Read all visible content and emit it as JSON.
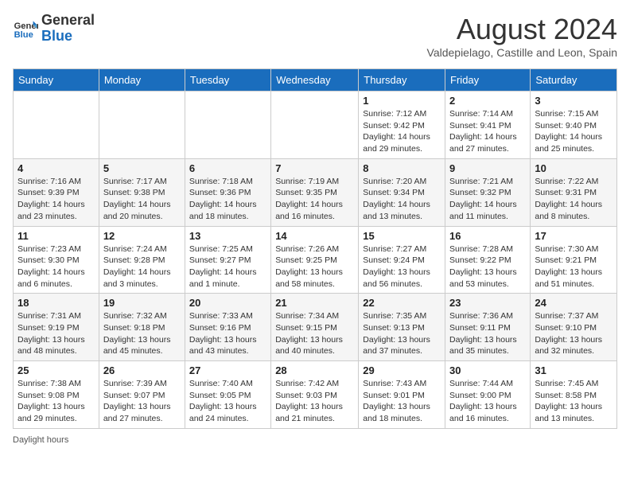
{
  "header": {
    "logo_line1": "General",
    "logo_line2": "Blue",
    "month_year": "August 2024",
    "location": "Valdepielago, Castille and Leon, Spain"
  },
  "footer": {
    "daylight_label": "Daylight hours"
  },
  "weekdays": [
    "Sunday",
    "Monday",
    "Tuesday",
    "Wednesday",
    "Thursday",
    "Friday",
    "Saturday"
  ],
  "weeks": [
    [
      {
        "day": "",
        "info": ""
      },
      {
        "day": "",
        "info": ""
      },
      {
        "day": "",
        "info": ""
      },
      {
        "day": "",
        "info": ""
      },
      {
        "day": "1",
        "info": "Sunrise: 7:12 AM\nSunset: 9:42 PM\nDaylight: 14 hours\nand 29 minutes."
      },
      {
        "day": "2",
        "info": "Sunrise: 7:14 AM\nSunset: 9:41 PM\nDaylight: 14 hours\nand 27 minutes."
      },
      {
        "day": "3",
        "info": "Sunrise: 7:15 AM\nSunset: 9:40 PM\nDaylight: 14 hours\nand 25 minutes."
      }
    ],
    [
      {
        "day": "4",
        "info": "Sunrise: 7:16 AM\nSunset: 9:39 PM\nDaylight: 14 hours\nand 23 minutes."
      },
      {
        "day": "5",
        "info": "Sunrise: 7:17 AM\nSunset: 9:38 PM\nDaylight: 14 hours\nand 20 minutes."
      },
      {
        "day": "6",
        "info": "Sunrise: 7:18 AM\nSunset: 9:36 PM\nDaylight: 14 hours\nand 18 minutes."
      },
      {
        "day": "7",
        "info": "Sunrise: 7:19 AM\nSunset: 9:35 PM\nDaylight: 14 hours\nand 16 minutes."
      },
      {
        "day": "8",
        "info": "Sunrise: 7:20 AM\nSunset: 9:34 PM\nDaylight: 14 hours\nand 13 minutes."
      },
      {
        "day": "9",
        "info": "Sunrise: 7:21 AM\nSunset: 9:32 PM\nDaylight: 14 hours\nand 11 minutes."
      },
      {
        "day": "10",
        "info": "Sunrise: 7:22 AM\nSunset: 9:31 PM\nDaylight: 14 hours\nand 8 minutes."
      }
    ],
    [
      {
        "day": "11",
        "info": "Sunrise: 7:23 AM\nSunset: 9:30 PM\nDaylight: 14 hours\nand 6 minutes."
      },
      {
        "day": "12",
        "info": "Sunrise: 7:24 AM\nSunset: 9:28 PM\nDaylight: 14 hours\nand 3 minutes."
      },
      {
        "day": "13",
        "info": "Sunrise: 7:25 AM\nSunset: 9:27 PM\nDaylight: 14 hours\nand 1 minute."
      },
      {
        "day": "14",
        "info": "Sunrise: 7:26 AM\nSunset: 9:25 PM\nDaylight: 13 hours\nand 58 minutes."
      },
      {
        "day": "15",
        "info": "Sunrise: 7:27 AM\nSunset: 9:24 PM\nDaylight: 13 hours\nand 56 minutes."
      },
      {
        "day": "16",
        "info": "Sunrise: 7:28 AM\nSunset: 9:22 PM\nDaylight: 13 hours\nand 53 minutes."
      },
      {
        "day": "17",
        "info": "Sunrise: 7:30 AM\nSunset: 9:21 PM\nDaylight: 13 hours\nand 51 minutes."
      }
    ],
    [
      {
        "day": "18",
        "info": "Sunrise: 7:31 AM\nSunset: 9:19 PM\nDaylight: 13 hours\nand 48 minutes."
      },
      {
        "day": "19",
        "info": "Sunrise: 7:32 AM\nSunset: 9:18 PM\nDaylight: 13 hours\nand 45 minutes."
      },
      {
        "day": "20",
        "info": "Sunrise: 7:33 AM\nSunset: 9:16 PM\nDaylight: 13 hours\nand 43 minutes."
      },
      {
        "day": "21",
        "info": "Sunrise: 7:34 AM\nSunset: 9:15 PM\nDaylight: 13 hours\nand 40 minutes."
      },
      {
        "day": "22",
        "info": "Sunrise: 7:35 AM\nSunset: 9:13 PM\nDaylight: 13 hours\nand 37 minutes."
      },
      {
        "day": "23",
        "info": "Sunrise: 7:36 AM\nSunset: 9:11 PM\nDaylight: 13 hours\nand 35 minutes."
      },
      {
        "day": "24",
        "info": "Sunrise: 7:37 AM\nSunset: 9:10 PM\nDaylight: 13 hours\nand 32 minutes."
      }
    ],
    [
      {
        "day": "25",
        "info": "Sunrise: 7:38 AM\nSunset: 9:08 PM\nDaylight: 13 hours\nand 29 minutes."
      },
      {
        "day": "26",
        "info": "Sunrise: 7:39 AM\nSunset: 9:07 PM\nDaylight: 13 hours\nand 27 minutes."
      },
      {
        "day": "27",
        "info": "Sunrise: 7:40 AM\nSunset: 9:05 PM\nDaylight: 13 hours\nand 24 minutes."
      },
      {
        "day": "28",
        "info": "Sunrise: 7:42 AM\nSunset: 9:03 PM\nDaylight: 13 hours\nand 21 minutes."
      },
      {
        "day": "29",
        "info": "Sunrise: 7:43 AM\nSunset: 9:01 PM\nDaylight: 13 hours\nand 18 minutes."
      },
      {
        "day": "30",
        "info": "Sunrise: 7:44 AM\nSunset: 9:00 PM\nDaylight: 13 hours\nand 16 minutes."
      },
      {
        "day": "31",
        "info": "Sunrise: 7:45 AM\nSunset: 8:58 PM\nDaylight: 13 hours\nand 13 minutes."
      }
    ]
  ]
}
